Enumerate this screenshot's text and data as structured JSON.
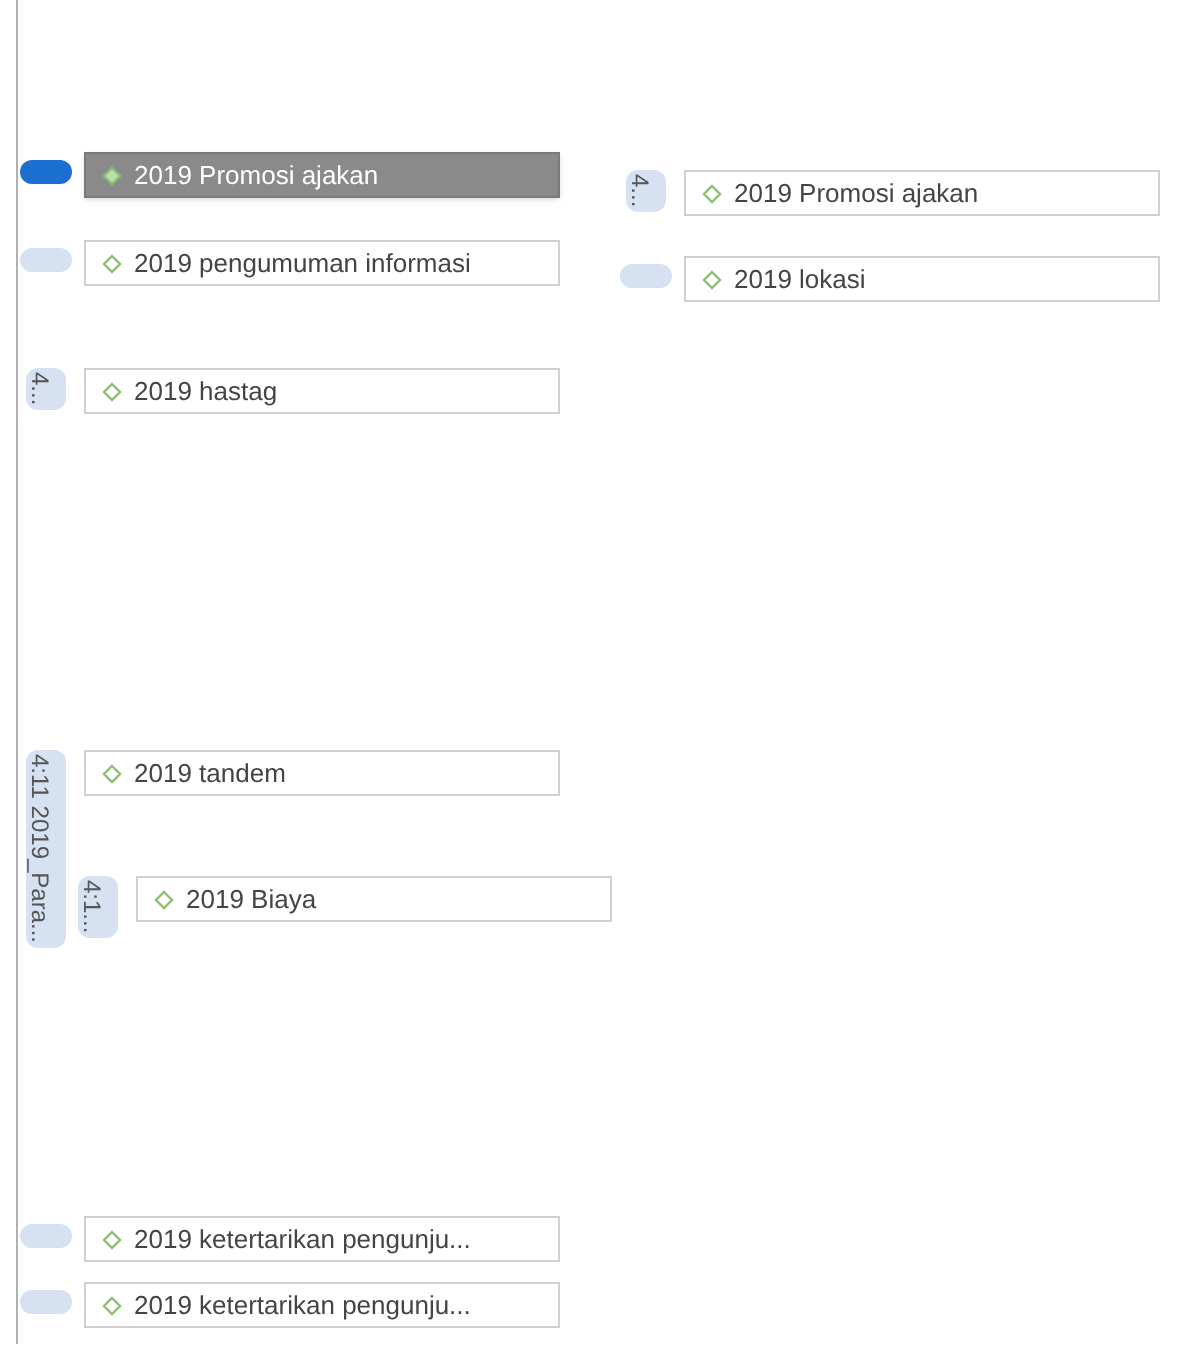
{
  "groups": [
    {
      "selected": true,
      "codes": [
        {
          "label": "2019 Promosi ajakan",
          "selected": true
        }
      ]
    },
    {
      "selected": false,
      "codes": [
        {
          "label": "2019 pengumuman informasi",
          "selected": false
        }
      ]
    },
    {
      "tab": "4...",
      "selected": false,
      "codes": [
        {
          "label": "2019 hastag",
          "selected": false
        }
      ]
    },
    {
      "tab": "4...",
      "selected": false,
      "codes": [
        {
          "label": "2019 Promosi ajakan",
          "selected": false
        }
      ]
    },
    {
      "selected": false,
      "codes": [
        {
          "label": "2019 lokasi",
          "selected": false
        }
      ]
    },
    {
      "tab": "4:11 2019_Para...",
      "selected": false,
      "codes": [
        {
          "label": "2019 tandem",
          "selected": false
        }
      ],
      "children": [
        {
          "tab": "4:1...",
          "selected": false,
          "codes": [
            {
              "label": "2019 Biaya",
              "selected": false
            }
          ]
        }
      ]
    },
    {
      "selected": false,
      "codes": [
        {
          "label": "2019 ketertarikan pengunju...",
          "selected": false
        }
      ]
    },
    {
      "selected": false,
      "codes": [
        {
          "label": "2019 ketertarikan pengunju...",
          "selected": false
        }
      ]
    }
  ]
}
